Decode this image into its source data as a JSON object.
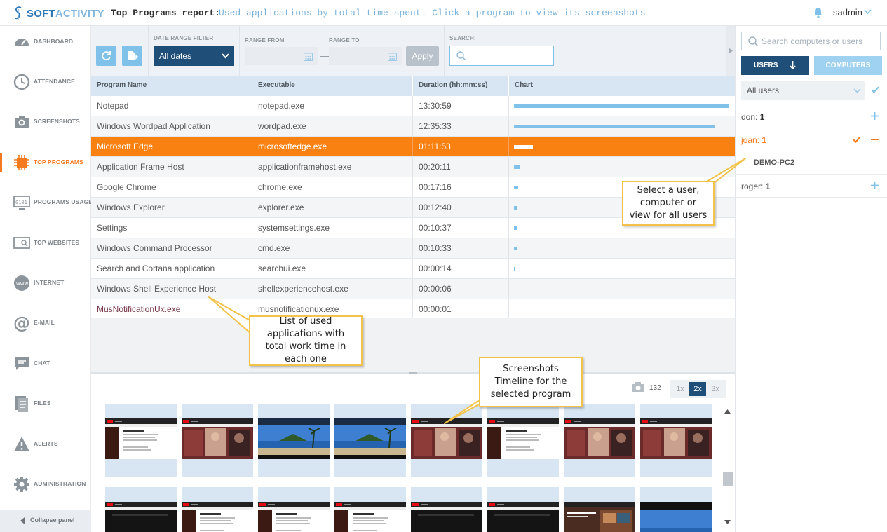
{
  "app": {
    "logo_text_a": "SOFT",
    "logo_text_b": "ACTIVITY",
    "user": "sadmin"
  },
  "report": {
    "title": "Top Programs report:",
    "description": "Used applications by total time spent. Click a program to view its screenshots"
  },
  "sidebar": {
    "items": [
      {
        "label": "DASHBOARD",
        "icon": "dashboard-icon"
      },
      {
        "label": "ATTENDANCE",
        "icon": "clock-icon"
      },
      {
        "label": "SCREENSHOTS",
        "icon": "camera-icon"
      },
      {
        "label": "TOP PROGRAMS",
        "icon": "chip-icon",
        "active": true
      },
      {
        "label": "PROGRAMS USAGE",
        "icon": "binary-monitor-icon"
      },
      {
        "label": "TOP WEBSITES",
        "icon": "web-search-icon"
      },
      {
        "label": "INTERNET",
        "icon": "www-icon"
      },
      {
        "label": "E-MAIL",
        "icon": "at-icon"
      },
      {
        "label": "CHAT",
        "icon": "chat-icon"
      },
      {
        "label": "FILES",
        "icon": "files-icon"
      },
      {
        "label": "ALERTS",
        "icon": "alert-icon"
      },
      {
        "label": "ADMINISTRATION",
        "icon": "gear-icon"
      }
    ],
    "collapse_label": "Collapse panel"
  },
  "filters": {
    "date_range_label": "DATE RANGE FILTER",
    "date_range_value": "All dates",
    "range_from_label": "RANGE FROM",
    "range_to_label": "RANGE TO",
    "apply_label": "Apply",
    "search_label": "SEARCH:",
    "search_value": ""
  },
  "table": {
    "headers": [
      "Program Name",
      "Executable",
      "Duration (hh:mm:ss)",
      "Chart"
    ],
    "rows": [
      {
        "name": "Notepad",
        "exe": "notepad.exe",
        "duration": "13:30:59",
        "share": 1.0
      },
      {
        "name": "Windows Wordpad Application",
        "exe": "wordpad.exe",
        "duration": "12:35:33",
        "share": 0.93
      },
      {
        "name": "Microsoft Edge",
        "exe": "microsoftedge.exe",
        "duration": "01:11:53",
        "share": 0.088,
        "selected": true
      },
      {
        "name": "Application Frame Host",
        "exe": "applicationframehost.exe",
        "duration": "00:20:11",
        "share": 0.025
      },
      {
        "name": "Google Chrome",
        "exe": "chrome.exe",
        "duration": "00:17:16",
        "share": 0.021
      },
      {
        "name": "Windows Explorer",
        "exe": "explorer.exe",
        "duration": "00:12:40",
        "share": 0.016
      },
      {
        "name": "Settings",
        "exe": "systemsettings.exe",
        "duration": "00:10:37",
        "share": 0.013
      },
      {
        "name": "Windows Command Processor",
        "exe": "cmd.exe",
        "duration": "00:10:33",
        "share": 0.013
      },
      {
        "name": "Search and Cortana application",
        "exe": "searchui.exe",
        "duration": "00:00:14",
        "share": 0.004
      },
      {
        "name": "Windows Shell Experience Host",
        "exe": "shellexperiencehost.exe",
        "duration": "00:00:06",
        "share": 0
      },
      {
        "name": "MusNotificationUx.exe",
        "exe": "musnotificationux.exe",
        "duration": "00:00:01",
        "share": 0
      }
    ]
  },
  "timeline": {
    "screenshot_count": "132",
    "zoom_options": [
      "1x",
      "2x",
      "3x"
    ],
    "zoom_selected": "2x"
  },
  "right_panel": {
    "search_placeholder": "Search computers or users",
    "tab_users": "USERS",
    "tab_computers": "COMPUTERS",
    "filter_value": "All users",
    "entries": [
      {
        "name": "don:",
        "count": "1"
      },
      {
        "name": "joan:",
        "count": "1",
        "active": true
      },
      {
        "name": "roger:",
        "count": "1"
      }
    ],
    "computer": "DEMO-PC2"
  },
  "callouts": {
    "select_user": "Select a user, computer or view for all users",
    "list_apps": "List of used applications with total work time in each one",
    "timeline": "Screenshots Timeline for the selected program"
  },
  "colors": {
    "accent_orange": "#f98111",
    "navy": "#1f4e79",
    "light_blue": "#7fc1e8",
    "header_blue": "#d7e6f2"
  }
}
